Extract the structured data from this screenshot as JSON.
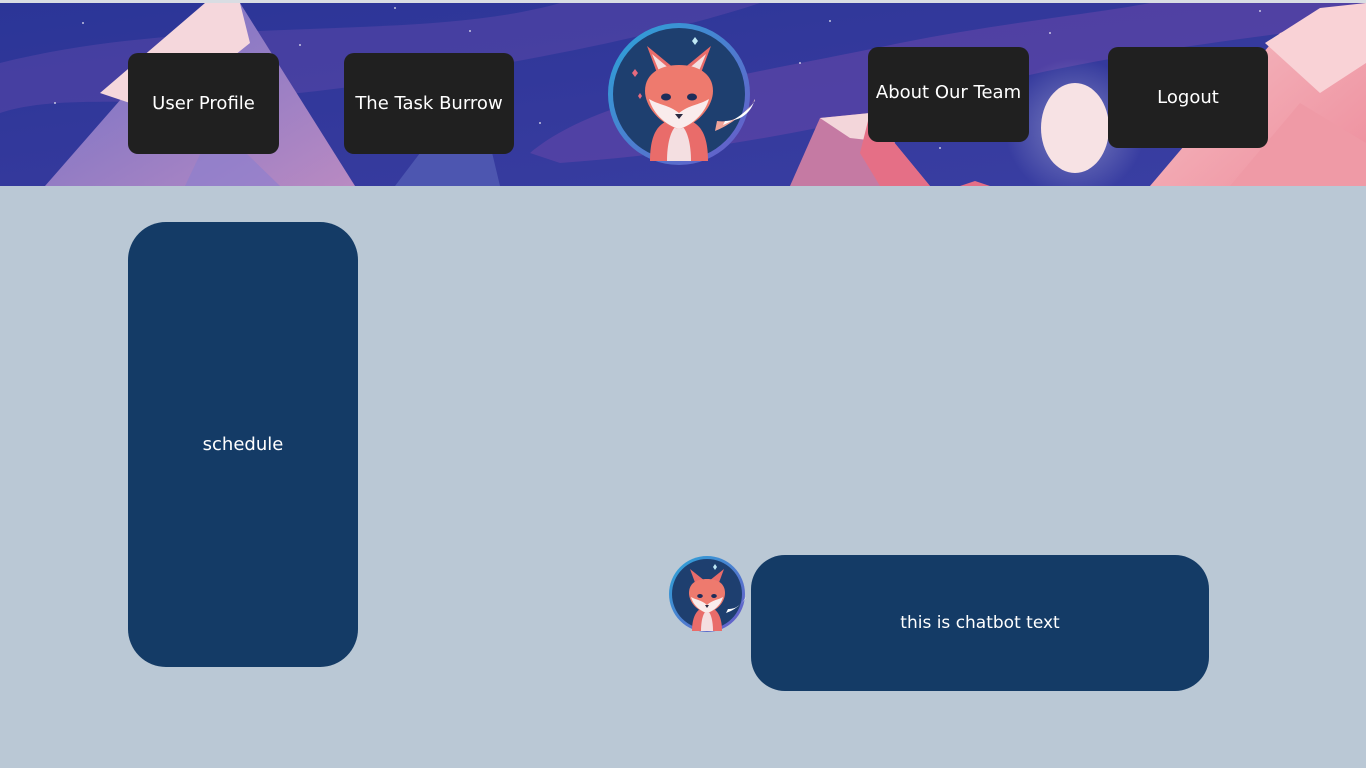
{
  "nav": {
    "user_profile": "User Profile",
    "task_burrow": "The Task Burrow",
    "about_team": "About Our Team",
    "logout": "Logout"
  },
  "logo": {
    "icon": "fox-logo-icon"
  },
  "schedule": {
    "label": "schedule"
  },
  "chatbot": {
    "avatar_icon": "fox-avatar-icon",
    "message": "this is chatbot text"
  },
  "colors": {
    "page_background": "#bac8d5",
    "panel": "#143b66",
    "nav_button": "#202020",
    "header_sky": "#2f3a9a",
    "mountain_pink": "#f2a7b0",
    "moon": "#f7e2e4"
  }
}
